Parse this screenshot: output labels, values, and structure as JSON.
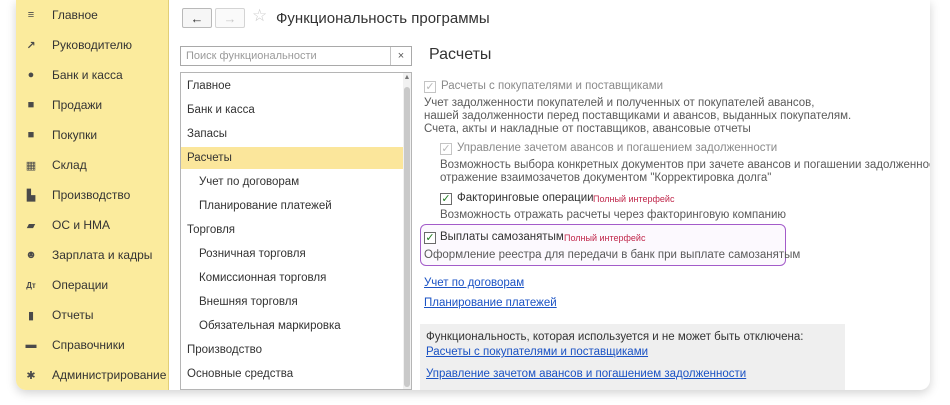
{
  "nav": {
    "items": [
      {
        "label": "Главное",
        "icon": "≡",
        "icon_name": "menu-icon"
      },
      {
        "label": "Руководителю",
        "icon": "↗",
        "icon_name": "trend-icon"
      },
      {
        "label": "Банк и касса",
        "icon": "●",
        "icon_name": "coin-icon"
      },
      {
        "label": "Продажи",
        "icon": "■",
        "icon_name": "bag-icon"
      },
      {
        "label": "Покупки",
        "icon": "■",
        "icon_name": "cart-icon"
      },
      {
        "label": "Склад",
        "icon": "▦",
        "icon_name": "warehouse-icon"
      },
      {
        "label": "Производство",
        "icon": "▙",
        "icon_name": "factory-icon"
      },
      {
        "label": "ОС и НМА",
        "icon": "▰",
        "icon_name": "truck-icon"
      },
      {
        "label": "Зарплата и кадры",
        "icon": "☻",
        "icon_name": "people-icon"
      },
      {
        "label": "Операции",
        "icon": "Дт",
        "icon_name": "debit-credit-icon"
      },
      {
        "label": "Отчеты",
        "icon": "▮",
        "icon_name": "bar-chart-icon"
      },
      {
        "label": "Справочники",
        "icon": "▬",
        "icon_name": "book-icon"
      },
      {
        "label": "Администрирование",
        "icon": "✱",
        "icon_name": "gear-icon"
      }
    ]
  },
  "header": {
    "back_icon": "←",
    "forward_icon": "→",
    "star_icon": "☆",
    "title": "Функциональность программы"
  },
  "search": {
    "placeholder": "Поиск функциональности",
    "clear_icon": "×"
  },
  "sections": [
    {
      "label": "Главное",
      "indent": false,
      "active": false
    },
    {
      "label": "Банк и касса",
      "indent": false,
      "active": false
    },
    {
      "label": "Запасы",
      "indent": false,
      "active": false
    },
    {
      "label": "Расчеты",
      "indent": false,
      "active": true
    },
    {
      "label": "Учет по договорам",
      "indent": true,
      "active": false
    },
    {
      "label": "Планирование платежей",
      "indent": true,
      "active": false
    },
    {
      "label": "Торговля",
      "indent": false,
      "active": false
    },
    {
      "label": "Розничная торговля",
      "indent": true,
      "active": false
    },
    {
      "label": "Комиссионная торговля",
      "indent": true,
      "active": false
    },
    {
      "label": "Внешняя торговля",
      "indent": true,
      "active": false
    },
    {
      "label": "Обязательная маркировка",
      "indent": true,
      "active": false
    },
    {
      "label": "Производство",
      "indent": false,
      "active": false
    },
    {
      "label": "Основные средства",
      "indent": false,
      "active": false
    }
  ],
  "content": {
    "title": "Расчеты",
    "check_mark": "✓",
    "opt1": {
      "label": "Расчеты с покупателями и поставщиками",
      "desc": [
        "Учет задолженности покупателей и полученных от покупателей авансов,",
        "нашей задолженности перед поставщиками и авансов, выданных покупателям.",
        "Счета, акты и накладные от поставщиков, авансовые отчеты"
      ]
    },
    "opt2": {
      "label": "Управление зачетом авансов и погашением задолженности",
      "desc": [
        "Возможность выбора конкретных документов при зачете авансов и погашении задолженности,",
        "отражение взаимозачетов документом \"Корректировка долга\""
      ]
    },
    "opt3": {
      "label": "Факторинговые операции",
      "badge": "Полный интерфейс",
      "desc": [
        "Возможность отражать расчеты через факторинговую компанию"
      ]
    },
    "opt4": {
      "label": "Выплаты самозанятым",
      "badge": "Полный интерфейс",
      "desc": [
        "Оформление реестра для передачи в банк при выплате самозанятым"
      ]
    },
    "links": [
      "Учет по договорам",
      "Планирование платежей"
    ],
    "box": {
      "title": "Функциональность, которая используется и не может быть отключена:",
      "links": [
        "Расчеты с покупателями и поставщиками",
        "Управление зачетом авансов и погашением задолженности"
      ]
    }
  }
}
